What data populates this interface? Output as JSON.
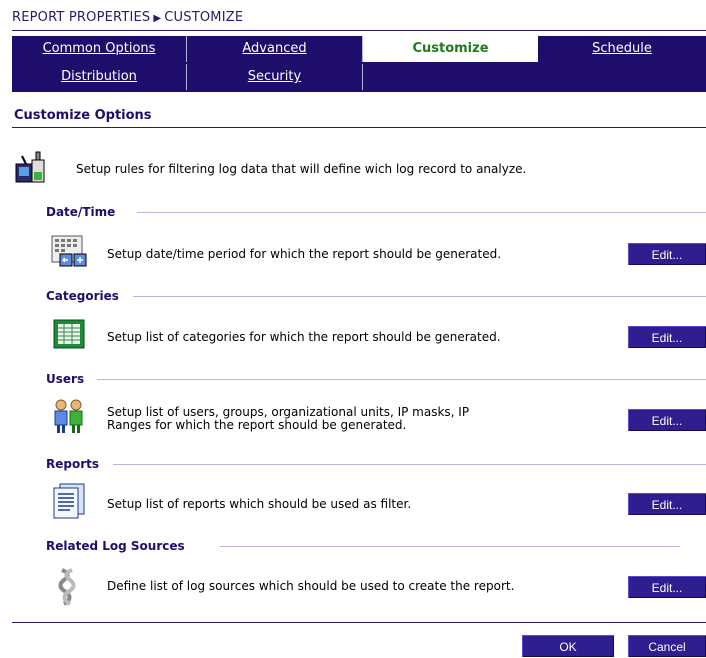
{
  "breadcrumb": {
    "parent": "REPORT PROPERTIES",
    "arrow": "▶",
    "current": "CUSTOMIZE"
  },
  "tabs": {
    "common_options": "Common Options",
    "advanced": "Advanced",
    "customize": "Customize",
    "schedule": "Schedule",
    "distribution": "Distribution",
    "security": "Security"
  },
  "section": {
    "title": "Customize Options"
  },
  "intro": {
    "text": "Setup rules for filtering log data that will define wich log record to analyze."
  },
  "groups": {
    "datetime": {
      "title": "Date/Time",
      "text": "Setup date/time period for which the report should be generated.",
      "edit": "Edit..."
    },
    "categories": {
      "title": "Categories",
      "text": "Setup list of categories for which the report should be generated.",
      "edit": "Edit..."
    },
    "users": {
      "title": "Users",
      "text1": "Setup list of users, groups, organizational units, IP masks, IP",
      "text2": "Ranges for which the report should be generated.",
      "edit": "Edit..."
    },
    "reports": {
      "title": "Reports",
      "text": "Setup list of reports which should be used as filter.",
      "edit": "Edit..."
    },
    "log_sources": {
      "title": "Related Log Sources",
      "text": "Define list of log sources which should be used to create the report.",
      "edit": "Edit..."
    }
  },
  "footer": {
    "ok": "OK",
    "cancel": "Cancel"
  },
  "colors": {
    "navy": "#1f0d6b",
    "active_tab_text": "#1e7b1e",
    "button": "#2f1e8f"
  }
}
